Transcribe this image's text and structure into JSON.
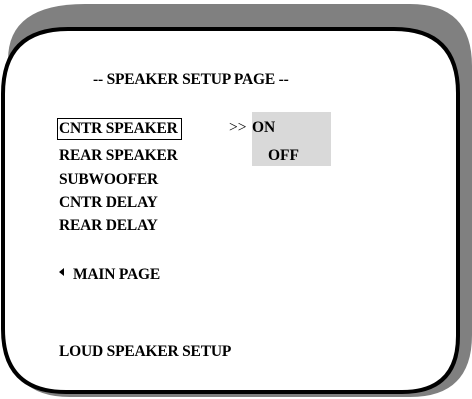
{
  "screen": {
    "title": "-- SPEAKER SETUP PAGE --"
  },
  "menu": {
    "items": [
      {
        "label": "CNTR SPEAKER",
        "selected": true
      },
      {
        "label": "REAR SPEAKER",
        "selected": false
      },
      {
        "label": "SUBWOOFER",
        "selected": false
      },
      {
        "label": "CNTR DELAY",
        "selected": false
      },
      {
        "label": "REAR DELAY",
        "selected": false
      }
    ]
  },
  "submenu": {
    "arrow": ">>",
    "options": [
      {
        "label": "ON",
        "highlighted": true
      },
      {
        "label": "OFF",
        "highlighted": false
      }
    ]
  },
  "navigation": {
    "back_icon": "left-triangle-icon",
    "back_label": "MAIN PAGE"
  },
  "footer": {
    "label": "LOUD SPEAKER SETUP"
  },
  "colors": {
    "frame_shadow": "#808080",
    "frame_border": "#000000",
    "screen_background": "#ffffff",
    "submenu_background": "#d9d9d9",
    "text": "#000000"
  }
}
